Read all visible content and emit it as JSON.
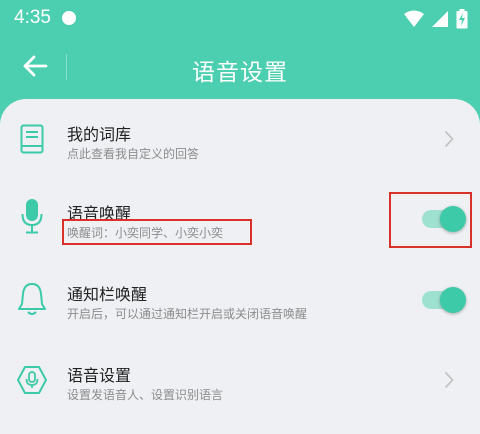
{
  "status_bar": {
    "time": "4:35",
    "icons": [
      "wifi-icon",
      "signal-icon",
      "battery-charging-icon"
    ]
  },
  "app_bar": {
    "title": "语音设置",
    "back_icon": "arrow-left-icon"
  },
  "colors": {
    "primary": "#4ccfb0",
    "toggle_on": "#3ccaa8",
    "toggle_track": "#9ee1d1",
    "highlight_box": "#d9302a",
    "background": "#eef0f3"
  },
  "settings": [
    {
      "icon": "book-icon",
      "title": "我的词库",
      "subtitle": "点此查看我自定义的回答",
      "control": "chevron"
    },
    {
      "icon": "microphone-icon",
      "title": "语音唤醒",
      "subtitle": "唤醒词：小奕同学、小奕小奕",
      "control": "toggle",
      "enabled": true
    },
    {
      "icon": "bell-icon",
      "title": "通知栏唤醒",
      "subtitle": "开启后，可以通过通知栏开启或关闭语音唤醒",
      "control": "toggle",
      "enabled": true
    },
    {
      "icon": "hexagon-microphone-icon",
      "title": "语音设置",
      "subtitle": "设置发语音人、设置识别语言",
      "control": "chevron"
    }
  ]
}
